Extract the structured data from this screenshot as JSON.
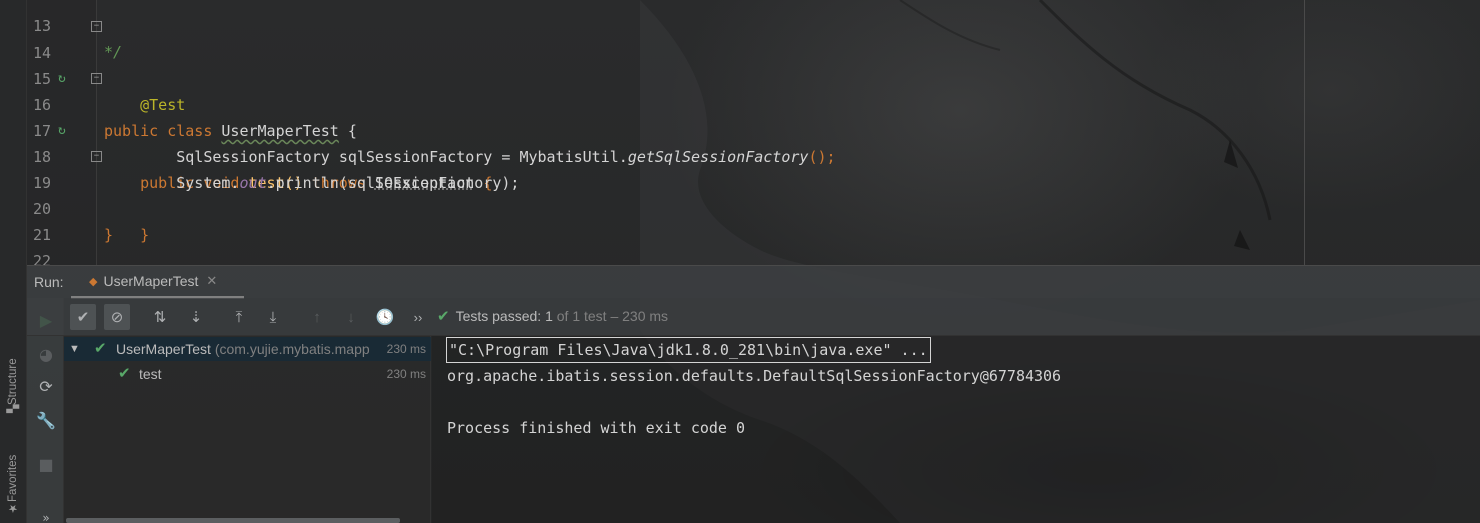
{
  "editor": {
    "lines": [
      {
        "num": "13",
        "comment": "*/"
      },
      {
        "num": "14",
        "kw1": "public",
        "kw2": "class",
        "class_name": "UserMaperTest",
        "brace": "{"
      },
      {
        "num": "15",
        "annotation": "@Test"
      },
      {
        "num": "16",
        "kw1": "public",
        "kw2": "void",
        "method": "test",
        "parens": "()",
        "throws": "throws",
        "exception": "IOException",
        "brace": "{"
      },
      {
        "num": "17",
        "type": "SqlSessionFactory",
        "var": "sqlSessionFactory",
        "eq": "=",
        "util": "MybatisUtil.",
        "call": "getSqlSessionFactory",
        "end": "();"
      },
      {
        "num": "18",
        "system": "System.",
        "out": "out",
        "println": ".println(sqlSessionFactory);"
      },
      {
        "num": "19",
        "close": "}"
      },
      {
        "num": "20",
        "close": "}"
      },
      {
        "num": "21"
      },
      {
        "num": "22"
      }
    ]
  },
  "left_strip": {
    "structure_label": "Structure",
    "favorites_label": "Favorites"
  },
  "run_panel": {
    "label": "Run:",
    "tab_label": "UserMaperTest",
    "status": {
      "prefix": "Tests passed:",
      "count": "1",
      "rest": "of 1 test – 230 ms"
    },
    "more_chevron": "››"
  },
  "test_tree": {
    "root": {
      "name": "UserMaperTest",
      "package": "(com.yujie.mybatis.mapp",
      "time": "230 ms"
    },
    "child": {
      "name": "test",
      "time": "230 ms"
    }
  },
  "console": {
    "lines": [
      "\"C:\\Program Files\\Java\\jdk1.8.0_281\\bin\\java.exe\" ...",
      "org.apache.ibatis.session.defaults.DefaultSqlSessionFactory@67784306",
      "",
      "Process finished with exit code 0"
    ]
  },
  "colors": {
    "keyword": "#cc7832",
    "annotation": "#bbb529",
    "method": "#ffc66d",
    "static_field": "#9876aa",
    "success": "#59a869"
  }
}
